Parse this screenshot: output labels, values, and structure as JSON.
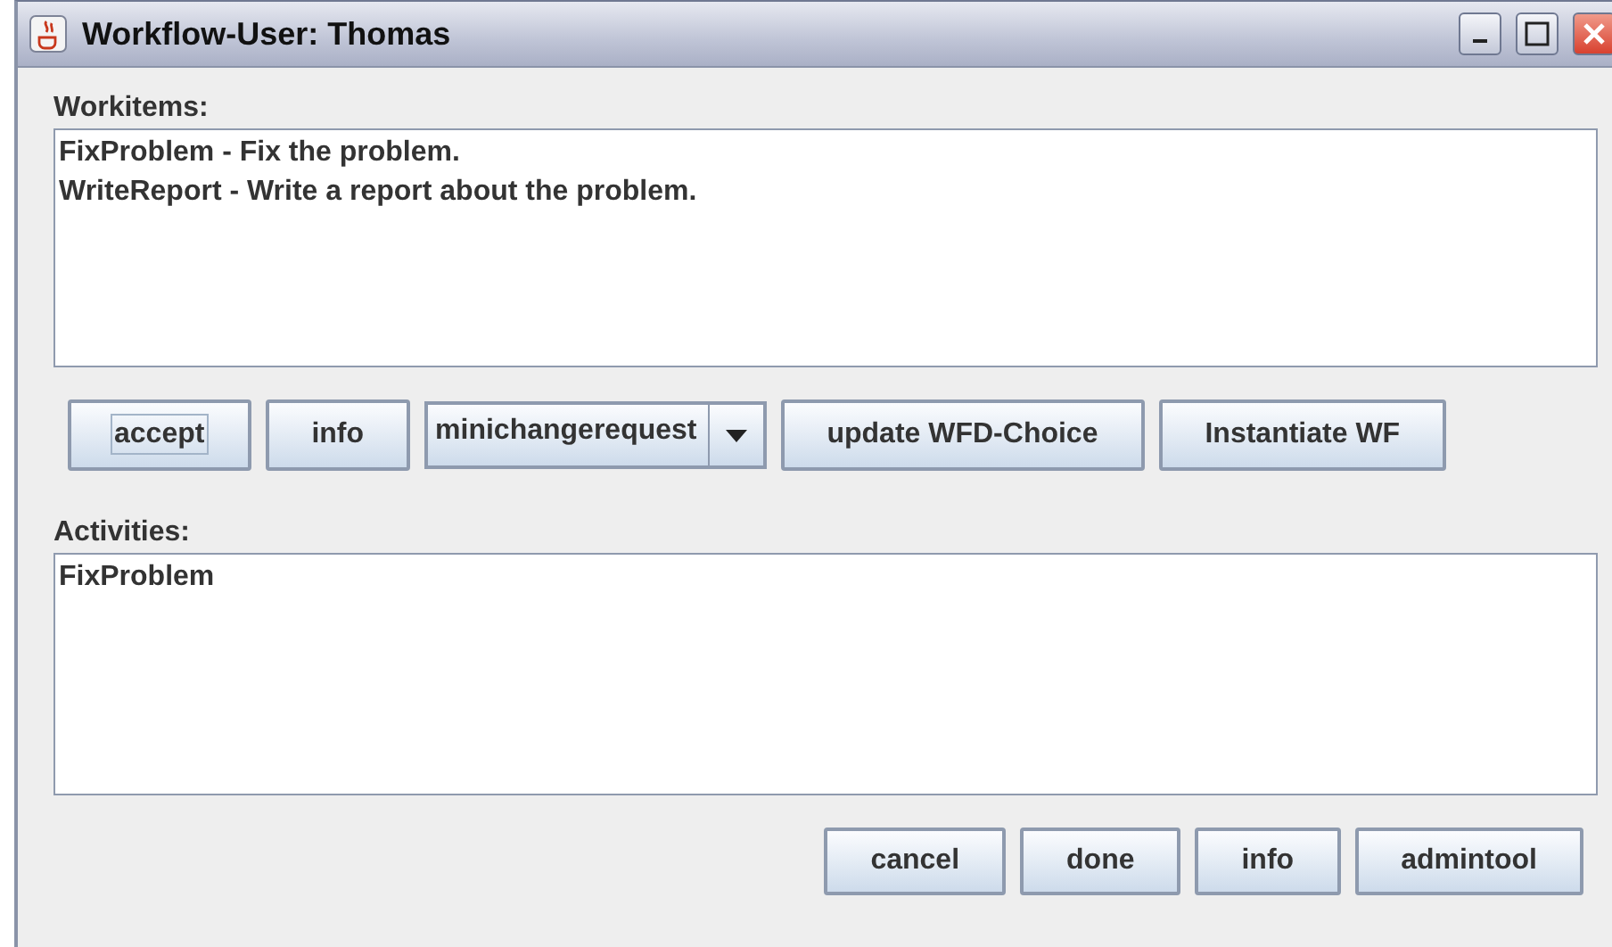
{
  "window": {
    "title": "Workflow-User: Thomas"
  },
  "workitems": {
    "label": "Workitems:",
    "items": [
      "FixProblem - Fix the problem.",
      "WriteReport - Write a report about the problem."
    ]
  },
  "toolbar": {
    "buttons": [
      {
        "label": "accept",
        "focused": true
      },
      {
        "label": "info",
        "focused": false
      }
    ],
    "combo": {
      "value": "minichangerequest"
    },
    "buttons_after": [
      {
        "label": "update WFD-Choice",
        "focused": false
      },
      {
        "label": "Instantiate WF",
        "focused": false
      }
    ]
  },
  "activities": {
    "label": "Activities:",
    "items": [
      "FixProblem"
    ]
  },
  "bottom_buttons": [
    "cancel",
    "done",
    "info",
    "admintool"
  ]
}
